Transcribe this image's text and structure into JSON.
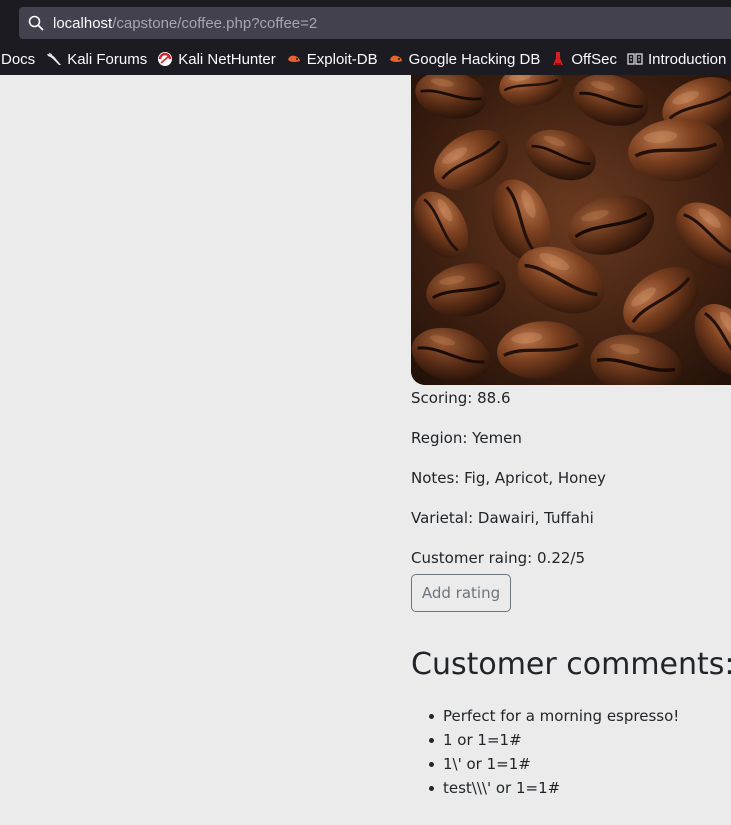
{
  "browser": {
    "url_host": "localhost",
    "url_path": "/capstone/coffee.php?coffee=2",
    "bookmarks": [
      {
        "label": "Docs",
        "icon": "none"
      },
      {
        "label": "Kali Forums",
        "icon": "kali-dragon-icon"
      },
      {
        "label": "Kali NetHunter",
        "icon": "nethunter-icon"
      },
      {
        "label": "Exploit-DB",
        "icon": "exploit-db-icon"
      },
      {
        "label": "Google Hacking DB",
        "icon": "ghdb-icon"
      },
      {
        "label": "OffSec",
        "icon": "offsec-icon"
      },
      {
        "label": "Introduction ·",
        "icon": "book-icon"
      }
    ]
  },
  "coffee": {
    "image_alt": "coffee-beans-photo",
    "scoring": "Scoring: 88.6",
    "region": "Region: Yemen",
    "notes": "Notes: Fig, Apricot, Honey",
    "varietal": "Varietal: Dawairi, Tuffahi",
    "customer_rating": "Customer raing: 0.22/5",
    "add_rating_label": "Add rating"
  },
  "comments": {
    "heading": "Customer comments:",
    "items": [
      "Perfect for a morning espresso!",
      "1 or 1=1#",
      "1\\' or 1=1#",
      "test\\\\\\' or 1=1#"
    ]
  },
  "colors": {
    "chrome_bg": "#1c1b22",
    "url_bar_bg": "#42414d",
    "page_bg": "#ebebeb",
    "text": "#212529",
    "button_border": "#6c757d"
  }
}
